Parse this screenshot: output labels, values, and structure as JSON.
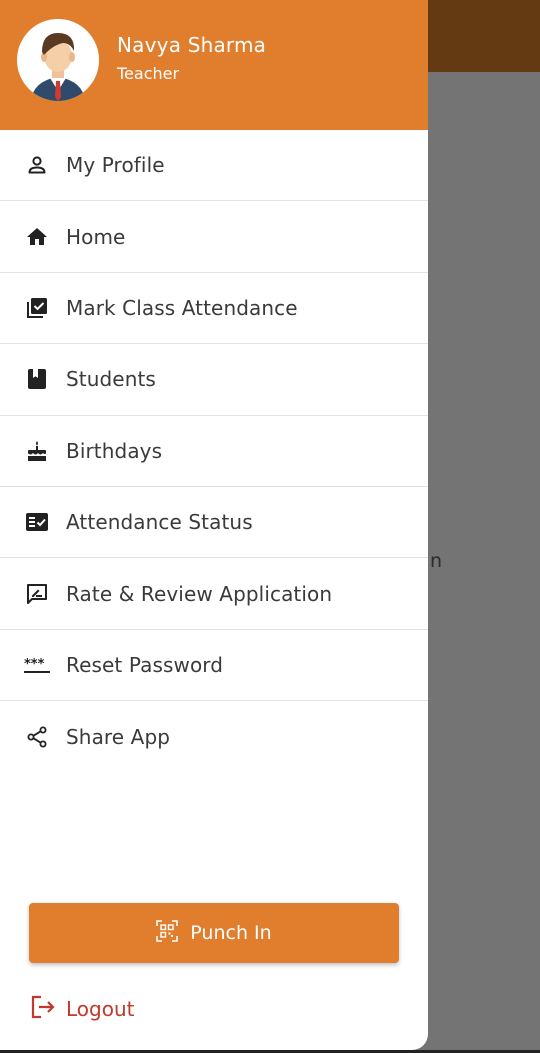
{
  "user": {
    "name": "Navya Sharma",
    "role": "Teacher"
  },
  "menu": [
    {
      "label": "My Profile",
      "icon": "person-icon"
    },
    {
      "label": "Home",
      "icon": "home-icon"
    },
    {
      "label": "Mark Class Attendance",
      "icon": "checklist-box-icon"
    },
    {
      "label": "Students",
      "icon": "book-icon"
    },
    {
      "label": "Birthdays",
      "icon": "cake-icon"
    },
    {
      "label": "Attendance Status",
      "icon": "fact-check-icon"
    },
    {
      "label": "Rate & Review Application",
      "icon": "rate-review-icon"
    },
    {
      "label": "Reset Password",
      "icon": "password-icon"
    },
    {
      "label": "Share App",
      "icon": "share-icon"
    }
  ],
  "punch_in": {
    "label": "Punch In",
    "icon": "qr-scan-icon"
  },
  "logout": {
    "label": "Logout",
    "icon": "logout-icon"
  },
  "background": {
    "fragment_text": "n"
  },
  "colors": {
    "accent": "#e07e2e",
    "appbar_bg": "#643a12",
    "scrim": "#747474",
    "logout_red": "#c0392b"
  }
}
